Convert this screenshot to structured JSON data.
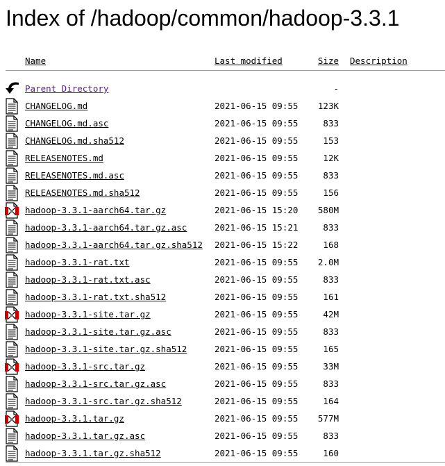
{
  "page": {
    "title": "Index of /hadoop/common/hadoop-3.3.1"
  },
  "columns": {
    "name": "Name",
    "last_modified": "Last modified",
    "size": "Size",
    "description": "Description"
  },
  "rows": [
    {
      "icon": "back-arrow-icon",
      "name": "Parent Directory",
      "modified": "",
      "size": "-"
    },
    {
      "icon": "text-file-icon",
      "name": "CHANGELOG.md",
      "modified": "2021-06-15 09:55",
      "size": "123K"
    },
    {
      "icon": "text-file-icon",
      "name": "CHANGELOG.md.asc",
      "modified": "2021-06-15 09:55",
      "size": "833"
    },
    {
      "icon": "text-file-icon",
      "name": "CHANGELOG.md.sha512",
      "modified": "2021-06-15 09:55",
      "size": "153"
    },
    {
      "icon": "text-file-icon",
      "name": "RELEASENOTES.md",
      "modified": "2021-06-15 09:55",
      "size": "12K"
    },
    {
      "icon": "text-file-icon",
      "name": "RELEASENOTES.md.asc",
      "modified": "2021-06-15 09:55",
      "size": "833"
    },
    {
      "icon": "text-file-icon",
      "name": "RELEASENOTES.md.sha512",
      "modified": "2021-06-15 09:55",
      "size": "156"
    },
    {
      "icon": "compressed-file-icon",
      "name": "hadoop-3.3.1-aarch64.tar.gz",
      "modified": "2021-06-15 15:20",
      "size": "580M"
    },
    {
      "icon": "text-file-icon",
      "name": "hadoop-3.3.1-aarch64.tar.gz.asc",
      "modified": "2021-06-15 15:21",
      "size": "833"
    },
    {
      "icon": "text-file-icon",
      "name": "hadoop-3.3.1-aarch64.tar.gz.sha512",
      "modified": "2021-06-15 15:22",
      "size": "168"
    },
    {
      "icon": "text-file-icon",
      "name": "hadoop-3.3.1-rat.txt",
      "modified": "2021-06-15 09:55",
      "size": "2.0M"
    },
    {
      "icon": "text-file-icon",
      "name": "hadoop-3.3.1-rat.txt.asc",
      "modified": "2021-06-15 09:55",
      "size": "833"
    },
    {
      "icon": "text-file-icon",
      "name": "hadoop-3.3.1-rat.txt.sha512",
      "modified": "2021-06-15 09:55",
      "size": "161"
    },
    {
      "icon": "compressed-file-icon",
      "name": "hadoop-3.3.1-site.tar.gz",
      "modified": "2021-06-15 09:55",
      "size": "42M"
    },
    {
      "icon": "text-file-icon",
      "name": "hadoop-3.3.1-site.tar.gz.asc",
      "modified": "2021-06-15 09:55",
      "size": "833"
    },
    {
      "icon": "text-file-icon",
      "name": "hadoop-3.3.1-site.tar.gz.sha512",
      "modified": "2021-06-15 09:55",
      "size": "165"
    },
    {
      "icon": "compressed-file-icon",
      "name": "hadoop-3.3.1-src.tar.gz",
      "modified": "2021-06-15 09:55",
      "size": "33M"
    },
    {
      "icon": "text-file-icon",
      "name": "hadoop-3.3.1-src.tar.gz.asc",
      "modified": "2021-06-15 09:55",
      "size": "833"
    },
    {
      "icon": "text-file-icon",
      "name": "hadoop-3.3.1-src.tar.gz.sha512",
      "modified": "2021-06-15 09:55",
      "size": "164"
    },
    {
      "icon": "compressed-file-icon",
      "name": "hadoop-3.3.1.tar.gz",
      "modified": "2021-06-15 09:55",
      "size": "577M"
    },
    {
      "icon": "text-file-icon",
      "name": "hadoop-3.3.1.tar.gz.asc",
      "modified": "2021-06-15 09:55",
      "size": "833"
    },
    {
      "icon": "text-file-icon",
      "name": "hadoop-3.3.1.tar.gz.sha512",
      "modified": "2021-06-15 09:55",
      "size": "160"
    }
  ],
  "colors": {
    "link": "#0000ee",
    "visited_link": "#551a8b",
    "rule": "#9a9a9a"
  }
}
